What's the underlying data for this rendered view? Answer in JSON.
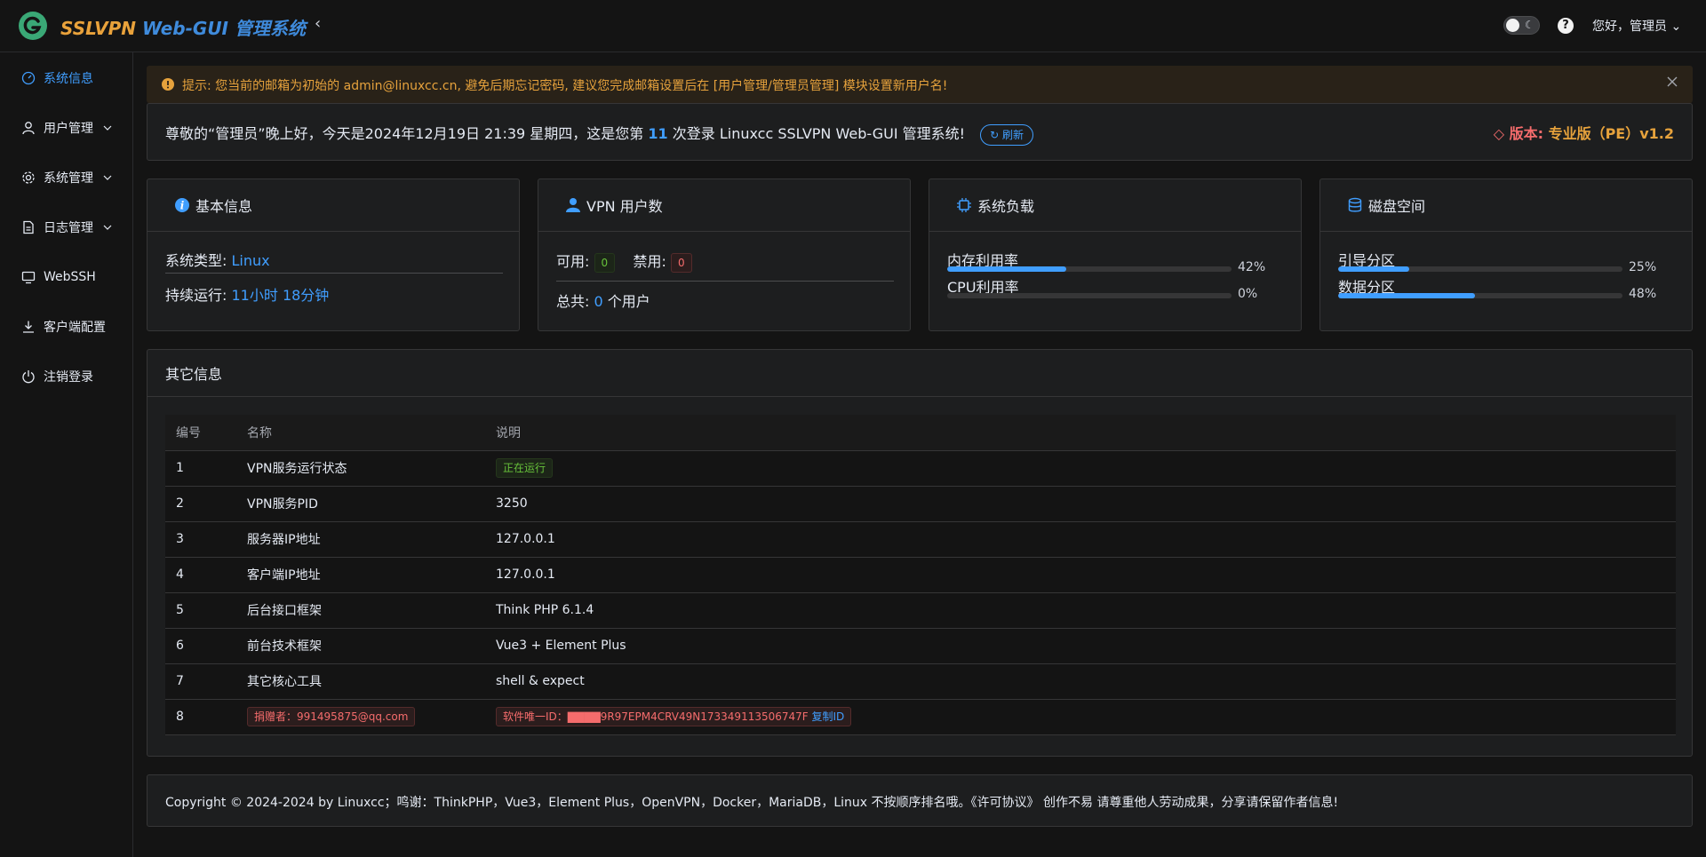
{
  "header": {
    "brand_part1": "SSLVPN",
    "brand_part2": "Web-GUI 管理系统",
    "collapse_glyph": "‹",
    "help_glyph": "?",
    "moon_glyph": "☾",
    "greeting": "您好，管理员",
    "chevron_glyph": "⌄"
  },
  "sidebar": {
    "items": [
      {
        "label": "系统信息",
        "icon": "dashboard-icon",
        "active": true
      },
      {
        "label": "用户管理",
        "icon": "user-icon",
        "expandable": true
      },
      {
        "label": "系统管理",
        "icon": "gear-icon",
        "expandable": true
      },
      {
        "label": "日志管理",
        "icon": "document-icon",
        "expandable": true
      },
      {
        "label": "WebSSH",
        "icon": "monitor-icon"
      },
      {
        "label": "客户端配置",
        "icon": "download-icon"
      },
      {
        "label": "注销登录",
        "icon": "power-icon"
      }
    ]
  },
  "alert": {
    "text": "提示: 您当前的邮箱为初始的 admin@linuxcc.cn, 避免后期忘记密码, 建议您完成邮箱设置后在 [用户管理/管理员管理] 模块设置新用户名!"
  },
  "welcome": {
    "prefix": "尊敬的“管理员”晚上好，今天是2024年12月19日 21:39 星期四，这是您第",
    "count": "11",
    "suffix": "次登录 Linuxcc SSLVPN Web-GUI 管理系统!",
    "refresh_label": "刷新",
    "version_label": "版本:",
    "version_value": "专业版（PE）v1.2"
  },
  "basic_info": {
    "title": "基本信息",
    "os_label": "系统类型:",
    "os_value": "Linux",
    "uptime_label": "持续运行:",
    "uptime_value": "11小时 18分钟"
  },
  "vpn_users": {
    "title": "VPN 用户数",
    "available_label": "可用:",
    "available_value": "0",
    "disabled_label": "禁用:",
    "disabled_value": "0",
    "total_label": "总共:",
    "total_value": "0",
    "total_suffix": "个用户"
  },
  "system_load": {
    "title": "系统负载",
    "memory_label": "内存利用率",
    "memory_pct": 42,
    "memory_text": "42%",
    "cpu_label": "CPU利用率",
    "cpu_pct": 0,
    "cpu_text": "0%"
  },
  "disk": {
    "title": "磁盘空间",
    "boot_label": "引导分区",
    "boot_pct": 25,
    "boot_text": "25%",
    "data_label": "数据分区",
    "data_pct": 48,
    "data_text": "48%"
  },
  "other_info": {
    "title": "其它信息",
    "columns": [
      "编号",
      "名称",
      "说明"
    ],
    "rows": [
      {
        "id": "1",
        "name": "VPN服务运行状态",
        "desc": "正在运行"
      },
      {
        "id": "2",
        "name": "VPN服务PID",
        "desc": "3250"
      },
      {
        "id": "3",
        "name": "服务器IP地址",
        "desc": "127.0.0.1"
      },
      {
        "id": "4",
        "name": "客户端IP地址",
        "desc": "127.0.0.1"
      },
      {
        "id": "5",
        "name": "后台接口框架",
        "desc": "Think PHP 6.1.4"
      },
      {
        "id": "6",
        "name": "前台技术框架",
        "desc": "Vue3 + Element Plus"
      },
      {
        "id": "7",
        "name": "其它核心工具",
        "desc": "shell & expect"
      },
      {
        "id": "8",
        "name": "捐赠者：991495875@qq.com",
        "desc": "软件唯一ID：▇▇▇▇9R97EPM4CRV49N173349113506747F",
        "copy": "复制ID"
      }
    ]
  },
  "footer": {
    "text": "Copyright © 2024-2024 by Linuxcc；鸣谢：ThinkPHP，Vue3，Element Plus，OpenVPN，Docker，MariaDB，Linux 不按顺序排名哦。《许可协议》 创作不易 请尊重他人劳动成果，分享请保留作者信息!"
  },
  "colors": {
    "accent": "#409eff",
    "warning": "#e6a23c",
    "danger": "#f56c6c",
    "success": "#67c23a",
    "brand_green": "#3aa876"
  }
}
